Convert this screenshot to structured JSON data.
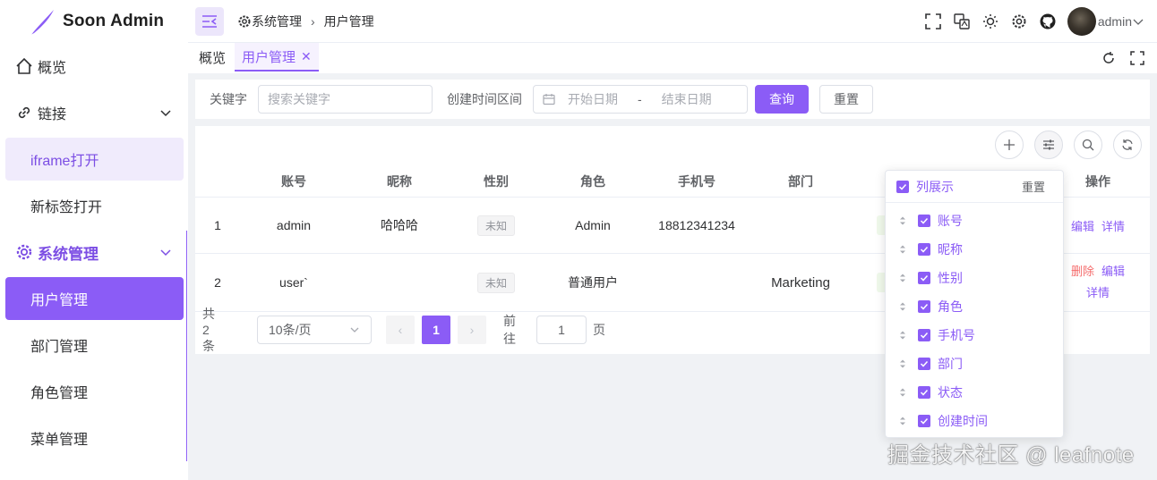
{
  "app": {
    "name": "Soon Admin"
  },
  "sidebar": {
    "items": [
      {
        "label": "概览"
      },
      {
        "label": "链接"
      },
      {
        "label": "iframe打开"
      },
      {
        "label": "新标签打开"
      },
      {
        "label": "系统管理"
      },
      {
        "label": "用户管理"
      },
      {
        "label": "部门管理"
      },
      {
        "label": "角色管理"
      },
      {
        "label": "菜单管理"
      }
    ]
  },
  "header": {
    "breadcrumb": [
      "系统管理",
      "用户管理"
    ],
    "user": "admin"
  },
  "tabs": [
    {
      "label": "概览"
    },
    {
      "label": "用户管理",
      "close": "✕"
    }
  ],
  "search": {
    "keyword_label": "关键字",
    "keyword_placeholder": "搜索关键字",
    "date_label": "创建时间区间",
    "start_placeholder": "开始日期",
    "date_sep": "-",
    "end_placeholder": "结束日期",
    "query_btn": "查询",
    "reset_btn": "重置"
  },
  "table": {
    "headers": [
      "账号",
      "昵称",
      "性别",
      "角色",
      "手机号",
      "部门",
      "操作"
    ],
    "rows": [
      {
        "index": "1",
        "account": "admin",
        "nickname": "哈哈哈",
        "gender": "未知",
        "role": "Admin",
        "phone": "18812341234",
        "dept": "",
        "actions": [
          "编辑",
          "详情"
        ]
      },
      {
        "index": "2",
        "account": "user`",
        "nickname": "",
        "gender": "未知",
        "role": "普通用户",
        "phone": "",
        "dept": "Marketing",
        "actions": [
          "删除",
          "编辑",
          "详情"
        ]
      }
    ]
  },
  "pagination": {
    "total": "共 2 条",
    "page_size": "10条/页",
    "prev": "‹",
    "current": "1",
    "next": "›",
    "goto_label": "前往",
    "goto_value": "1",
    "page_unit": "页"
  },
  "column_popover": {
    "title": "列展示",
    "reset": "重置",
    "columns": [
      "账号",
      "昵称",
      "性别",
      "角色",
      "手机号",
      "部门",
      "状态",
      "创建时间"
    ]
  },
  "watermark": "掘金技术社区 @ leafnote",
  "colors": {
    "primary": "#8b5cf6",
    "danger": "#f56c6c"
  }
}
